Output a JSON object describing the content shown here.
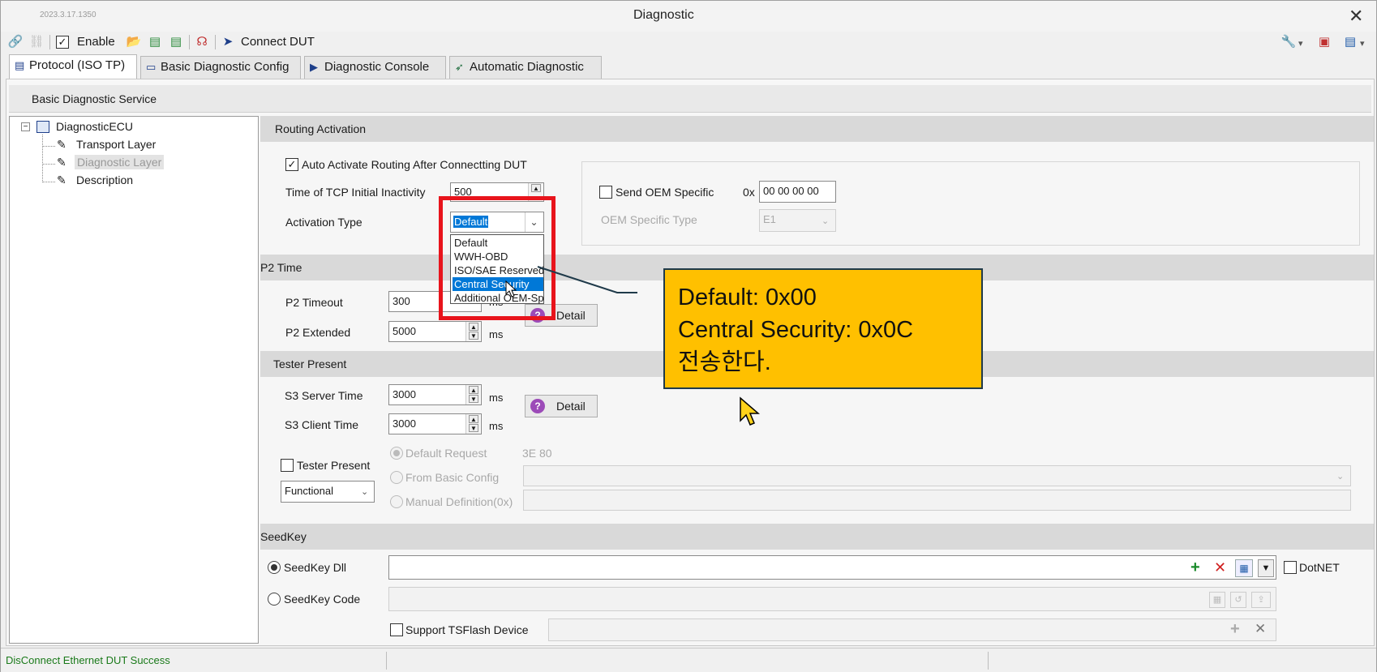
{
  "window": {
    "version": "2023.3.17.1350",
    "title": "Diagnostic",
    "close_glyph": "✕"
  },
  "toolbar": {
    "enable_label": "Enable",
    "connect_label": "Connect DUT"
  },
  "tabs": [
    {
      "label": "Protocol (ISO TP)"
    },
    {
      "label": "Basic Diagnostic Config"
    },
    {
      "label": "Diagnostic Console"
    },
    {
      "label": "Automatic Diagnostic"
    }
  ],
  "service": {
    "title": "Basic Diagnostic Service"
  },
  "tree": {
    "root": "DiagnosticECU",
    "children": [
      {
        "label": "Transport Layer"
      },
      {
        "label": "Diagnostic Layer"
      },
      {
        "label": "Description"
      }
    ]
  },
  "routing": {
    "header": "Routing Activation",
    "auto_activate_label": "Auto Activate Routing After Connectting DUT",
    "tcp_label": "Time of TCP Initial Inactivity",
    "tcp_value": "500",
    "activation_type_label": "Activation Type",
    "activation_type_value": "Default",
    "send_oem_label": "Send OEM Specific",
    "hex_prefix": "0x",
    "oem_hex_value": "00 00 00 00",
    "oem_type_label": "OEM Specific Type",
    "oem_type_value": "E1",
    "dropdown_options": [
      "Default",
      "WWH-OBD",
      "ISO/SAE Reserved",
      "Central Security",
      "Additional OEM-Sp"
    ]
  },
  "p2": {
    "header": "P2 Time",
    "timeout_label": "P2 Timeout",
    "timeout_value": "300",
    "timeout_unit": "ms",
    "extended_label": "P2 Extended",
    "extended_value": "5000",
    "extended_unit": "ms",
    "detail_label": "Detail"
  },
  "tester": {
    "header": "Tester Present",
    "s3_server_label": "S3 Server Time",
    "s3_server_value": "3000",
    "s3_server_unit": "ms",
    "s3_client_label": "S3 Client Time",
    "s3_client_value": "3000",
    "s3_client_unit": "ms",
    "detail_label": "Detail",
    "tester_present_label": "Tester Present",
    "addressing_value": "Functional",
    "default_request_label": "Default Request",
    "default_request_value": "3E 80",
    "from_basic_label": "From Basic Config",
    "manual_label": "Manual Definition(0x)"
  },
  "seedkey": {
    "header": "SeedKey",
    "dll_label": "SeedKey Dll",
    "code_label": "SeedKey Code",
    "dotnet_label": "DotNET",
    "tsflash_label": "Support TSFlash Device"
  },
  "callout": {
    "line1": "Default:  0x00",
    "line2": "Central  Security:  0x0C",
    "line3": "전송한다."
  },
  "status": {
    "message": "DisConnect Ethernet DUT Success"
  },
  "colors": {
    "highlight": "#e8141c",
    "callout_bg": "#ffc000",
    "selection": "#0078d7",
    "status_text": "#1a7a1a"
  }
}
